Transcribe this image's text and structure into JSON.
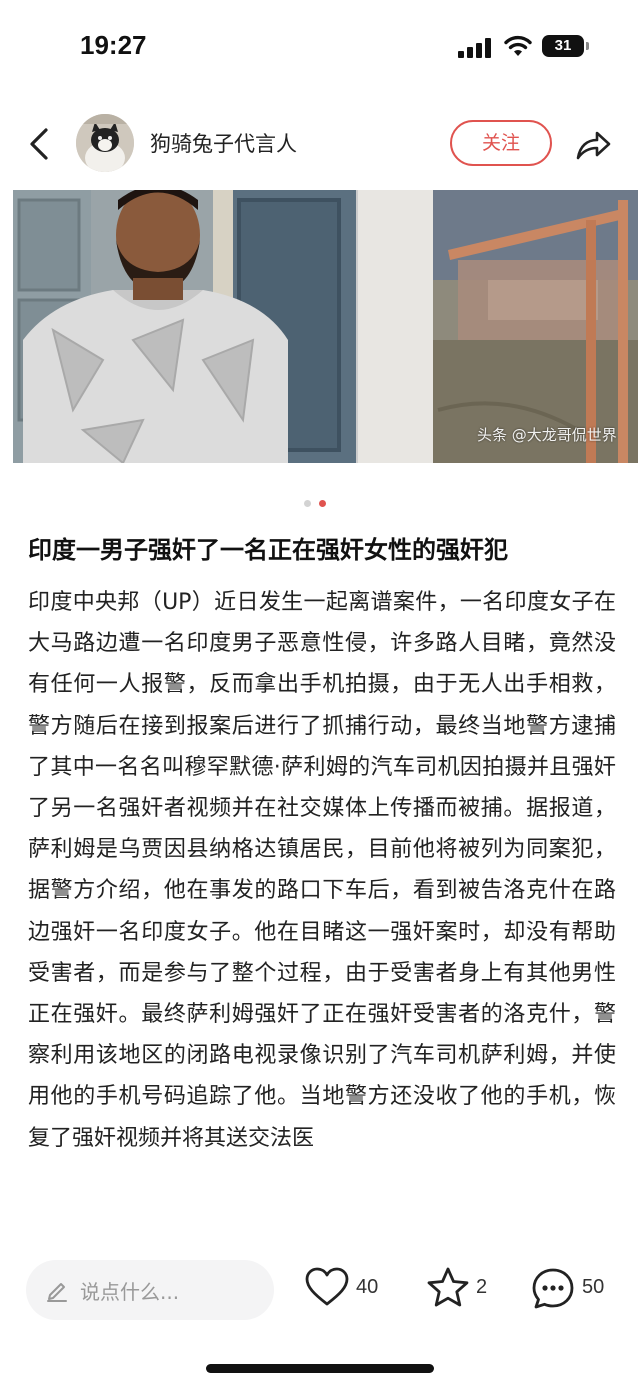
{
  "status_bar": {
    "time": "19:27",
    "battery": "31"
  },
  "header": {
    "author_name": "狗骑兔子代言人",
    "follow_label": "关注",
    "icons": {
      "back": "chevron-left-icon",
      "share": "share-arrow-icon"
    }
  },
  "carousel": {
    "watermark": "头条 @大龙哥侃世界",
    "page_count": 2,
    "active_index": 1,
    "colors": {
      "dot_active": "#e0534f",
      "dot_inactive": "#d3d3d3"
    }
  },
  "article": {
    "title": "印度一男子强奸了一名正在强奸女性的强奸犯",
    "body": "印度中央邦（UP）近日发生一起离谱案件，一名印度女子在大马路边遭一名印度男子恶意性侵，许多路人目睹，竟然没有任何一人报警，反而拿出手机拍摄，由于无人出手相救，警方随后在接到报案后进行了抓捕行动，最终当地警方逮捕了其中一名名叫穆罕默德·萨利姆的汽车司机因拍摄并且强奸了另一名强奸者视频并在社交媒体上传播而被捕。据报道，萨利姆是乌贾因县纳格达镇居民，目前他将被列为同案犯，据警方介绍，他在事发的路口下车后，看到被告洛克什在路边强奸一名印度女子。他在目睹这一强奸案时，却没有帮助受害者，而是参与了整个过程，由于受害者身上有其他男性正在强奸。最终萨利姆强奸了正在强奸受害者的洛克什，警察利用该地区的闭路电视录像识别了汽车司机萨利姆，并使用他的手机号码追踪了他。当地警方还没收了他的手机，恢复了强奸视频并将其送交法医"
  },
  "bottom_bar": {
    "comment_placeholder": "说点什么...",
    "likes": "40",
    "favorites": "2",
    "comments": "50",
    "icons": {
      "pen": "pencil-icon",
      "like": "heart-icon",
      "favorite": "star-icon",
      "comment": "chat-bubble-icon"
    }
  },
  "colors": {
    "accent": "#e0534f",
    "text": "#222222"
  }
}
